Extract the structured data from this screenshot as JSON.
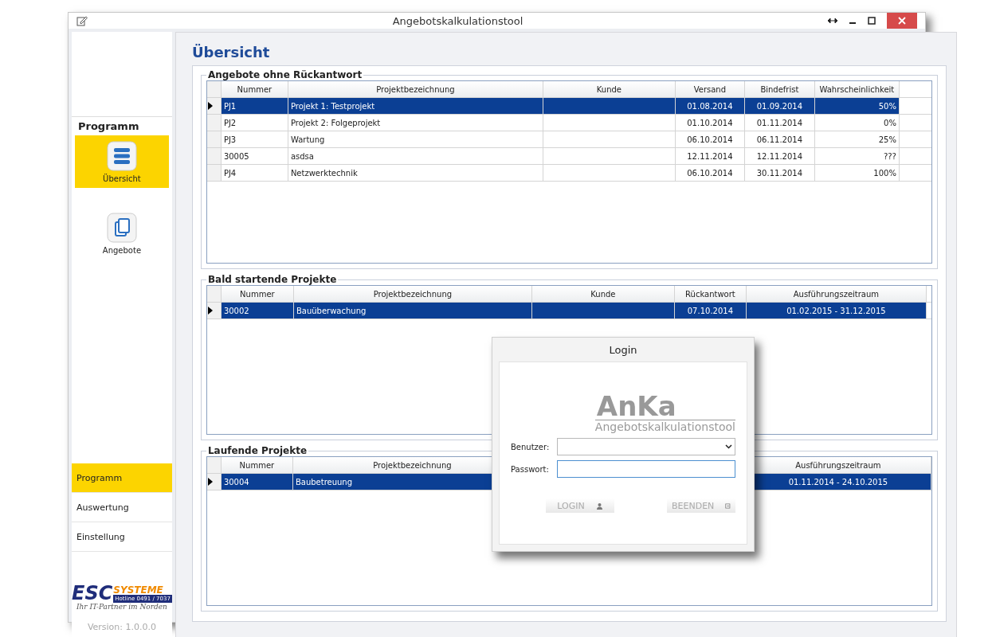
{
  "window": {
    "title": "Angebotskalkulationstool"
  },
  "sidebar": {
    "heading": "Programm",
    "items": [
      {
        "label": "Übersicht",
        "selected": true
      },
      {
        "label": "Angebote",
        "selected": false
      }
    ],
    "nav": [
      {
        "label": "Programm",
        "selected": true
      },
      {
        "label": "Auswertung",
        "selected": false
      },
      {
        "label": "Einstellung",
        "selected": false
      }
    ],
    "logo": {
      "brand": "ESC",
      "brand_suffix": "SYSTEME",
      "hotline": "Hotline 0491 / 7037",
      "slogan": "Ihr IT-Partner im Norden"
    },
    "version": "Version: 1.0.0.0"
  },
  "page_title": "Übersicht",
  "sections": [
    {
      "title": "Angebote ohne Rückantwort",
      "columns": [
        "Nummer",
        "Projektbezeichnung",
        "Kunde",
        "Versand",
        "Bindefrist",
        "Wahrscheinlichkeit"
      ],
      "rows": [
        {
          "selected": true,
          "cells": [
            "PJ1",
            "Projekt 1: Testprojekt",
            "",
            "01.08.2014",
            "01.09.2014",
            "50%"
          ]
        },
        {
          "selected": false,
          "cells": [
            "PJ2",
            "Projekt 2: Folgeprojekt",
            "",
            "01.10.2014",
            "01.11.2014",
            "0%"
          ]
        },
        {
          "selected": false,
          "cells": [
            "PJ3",
            "Wartung",
            "",
            "06.10.2014",
            "06.11.2014",
            "25%"
          ]
        },
        {
          "selected": false,
          "cells": [
            "30005",
            "asdsa",
            "",
            "12.11.2014",
            "12.11.2014",
            "???"
          ]
        },
        {
          "selected": false,
          "cells": [
            "PJ4",
            "Netzwerktechnik",
            "",
            "06.10.2014",
            "30.11.2014",
            "100%"
          ]
        }
      ]
    },
    {
      "title": "Bald startende Projekte",
      "columns": [
        "Nummer",
        "Projektbezeichnung",
        "Kunde",
        "Rückantwort",
        "Ausführungszeitraum"
      ],
      "rows": [
        {
          "selected": true,
          "cells": [
            "30002",
            "Bauüberwachung",
            "",
            "07.10.2014",
            "01.02.2015 - 31.12.2015"
          ]
        }
      ]
    },
    {
      "title": "Laufende Projekte",
      "columns": [
        "Nummer",
        "Projektbezeichnung",
        "Ausführungszeitraum"
      ],
      "rows": [
        {
          "selected": true,
          "cells": [
            "30004",
            "Baubetreuung",
            "01.11.2014 - 24.10.2015"
          ]
        }
      ]
    }
  ],
  "login": {
    "title": "Login",
    "logo": "AnKa",
    "subtitle": "Angebotskalkulationstool",
    "fields": [
      {
        "kind": "select",
        "label": "Benutzer:",
        "focused": false
      },
      {
        "kind": "password",
        "label": "Passwort:",
        "focused": true
      }
    ],
    "buttons": [
      {
        "label": "LOGIN",
        "disabled": true
      },
      {
        "label": "BEENDEN",
        "disabled": true
      }
    ]
  }
}
